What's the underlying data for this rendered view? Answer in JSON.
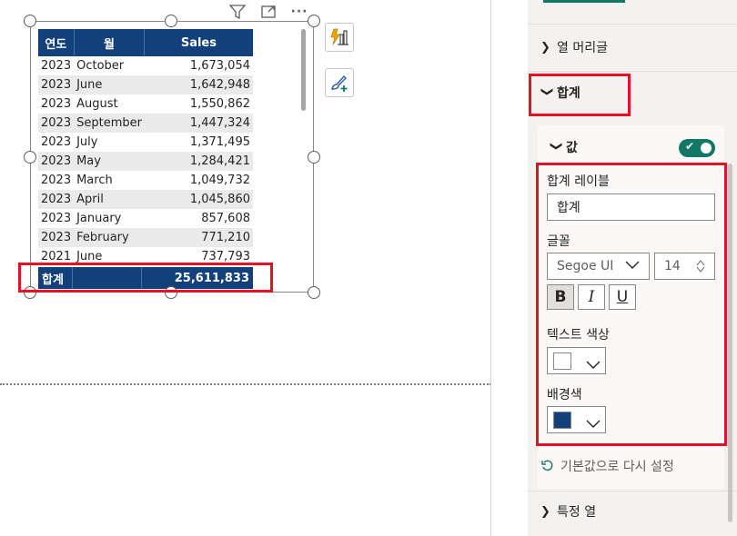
{
  "table": {
    "headers": [
      "연도",
      "월",
      "Sales"
    ],
    "rows": [
      [
        "2023",
        "October",
        "1,673,054"
      ],
      [
        "2023",
        "June",
        "1,642,948"
      ],
      [
        "2023",
        "August",
        "1,550,862"
      ],
      [
        "2023",
        "September",
        "1,447,324"
      ],
      [
        "2023",
        "July",
        "1,371,495"
      ],
      [
        "2023",
        "May",
        "1,284,421"
      ],
      [
        "2023",
        "March",
        "1,049,732"
      ],
      [
        "2023",
        "April",
        "1,045,860"
      ],
      [
        "2023",
        "January",
        "857,608"
      ],
      [
        "2023",
        "February",
        "771,210"
      ],
      [
        "2021",
        "June",
        "737,793"
      ]
    ],
    "total_label": "합계",
    "total_value": "25,611,833"
  },
  "icons": {
    "filter": "filter-icon",
    "focus": "focus-mode-icon",
    "more": "more-options-icon"
  },
  "pane": {
    "section_column_headers": "열 머리글",
    "section_totals": "합계",
    "card_title": "값",
    "label_total_label": "합계 레이블",
    "total_label_value": "합계",
    "label_font": "글꼴",
    "font_family": "Segoe UI",
    "font_size": "14",
    "bold": "B",
    "italic": "I",
    "underline": "U",
    "label_text_color": "텍스트 색상",
    "label_background": "배경색",
    "reset_label": "기본값으로 다시 설정",
    "section_specific_column": "특정 열"
  },
  "colors": {
    "header_bg": "#12407a",
    "text_color_swatch": "#ffffff",
    "background_swatch": "#12407a",
    "accent": "#117865",
    "highlight": "#e81123"
  }
}
